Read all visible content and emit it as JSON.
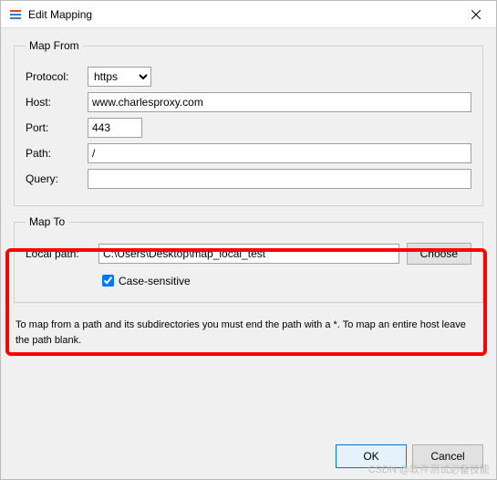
{
  "window": {
    "title": "Edit Mapping"
  },
  "mapFrom": {
    "legend": "Map From",
    "protocolLabel": "Protocol:",
    "protocolValue": "https",
    "hostLabel": "Host:",
    "hostValue": "www.charlesproxy.com",
    "portLabel": "Port:",
    "portValue": "443",
    "pathLabel": "Path:",
    "pathValue": "/",
    "queryLabel": "Query:",
    "queryValue": ""
  },
  "mapTo": {
    "legend": "Map To",
    "localPathLabel": "Local path:",
    "localPathValue": "C:\\Users\\Desktop\\map_local_test",
    "chooseLabel": "Choose",
    "caseSensitiveLabel": "Case-sensitive",
    "caseSensitiveChecked": true
  },
  "helpText": "To map from a path and its subdirectories you must end the path with a *. To map an entire host leave the path blank.",
  "buttons": {
    "ok": "OK",
    "cancel": "Cancel"
  },
  "watermark": "CSDN @软件测试必备技能"
}
